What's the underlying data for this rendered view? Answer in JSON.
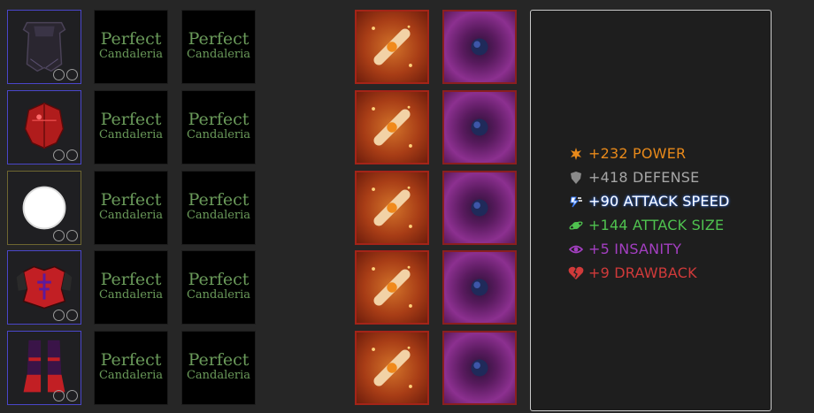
{
  "loadout": {
    "rows": [
      {
        "gear": {
          "item": "chest-cape",
          "rarity_color": "#4a46c9"
        },
        "enchant_a": {
          "name": "Perfect",
          "sub": "Candaleria"
        },
        "enchant_b": {
          "name": "Perfect",
          "sub": "Candaleria"
        }
      },
      {
        "gear": {
          "item": "red-helmet",
          "rarity_color": "#4a46c9"
        },
        "enchant_a": {
          "name": "Perfect",
          "sub": "Candaleria"
        },
        "enchant_b": {
          "name": "Perfect",
          "sub": "Candaleria"
        }
      },
      {
        "gear": {
          "item": "white-orb",
          "rarity_color": "#6e6630"
        },
        "enchant_a": {
          "name": "Perfect",
          "sub": "Candaleria"
        },
        "enchant_b": {
          "name": "Perfect",
          "sub": "Candaleria"
        }
      },
      {
        "gear": {
          "item": "red-chestplate",
          "rarity_color": "#4a46c9"
        },
        "enchant_a": {
          "name": "Perfect",
          "sub": "Candaleria"
        },
        "enchant_b": {
          "name": "Perfect",
          "sub": "Candaleria"
        }
      },
      {
        "gear": {
          "item": "red-boots",
          "rarity_color": "#4a46c9"
        },
        "enchant_a": {
          "name": "Perfect",
          "sub": "Candaleria"
        },
        "enchant_b": {
          "name": "Perfect",
          "sub": "Candaleria"
        }
      }
    ]
  },
  "stats": [
    {
      "icon": "power-burst-icon",
      "text": "+232 POWER",
      "color": "#e8891a"
    },
    {
      "icon": "shield-icon",
      "text": "+418 DEFENSE",
      "color": "#a6a6a6"
    },
    {
      "icon": "lightning-icon",
      "text": "+90 ATTACK SPEED",
      "color": "#ffffff",
      "glow": "#3a7dff"
    },
    {
      "icon": "expand-orbit-icon",
      "text": "+144 ATTACK SIZE",
      "color": "#4fc24f"
    },
    {
      "icon": "eye-icon",
      "text": "+5 INSANITY",
      "color": "#a43fc2"
    },
    {
      "icon": "broken-heart-icon",
      "text": "+9 DRAWBACK",
      "color": "#d03a3a"
    }
  ]
}
